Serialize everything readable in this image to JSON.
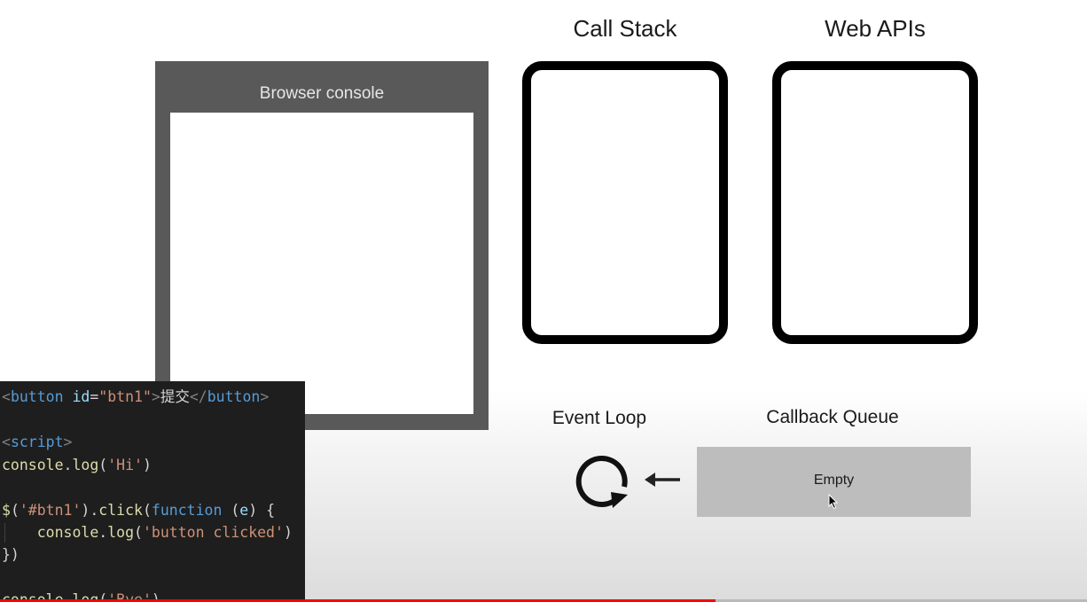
{
  "console": {
    "title": "Browser console"
  },
  "titles": {
    "call_stack": "Call Stack",
    "web_apis": "Web APIs",
    "event_loop": "Event Loop",
    "callback_queue": "Callback Queue"
  },
  "callback_queue": {
    "content": "Empty"
  },
  "icons": {
    "loop": "refresh-loop-icon",
    "arrow": "left-arrow-icon",
    "cursor": "mouse-pointer-icon"
  },
  "code": {
    "l1": {
      "t1": "<",
      "t2": "button",
      "t3": " ",
      "t4": "id",
      "t5": "=",
      "t6": "\"btn1\"",
      "t7": ">",
      "t8": "提交",
      "t9": "</",
      "t10": "button",
      "t11": ">"
    },
    "l3": {
      "t1": "<",
      "t2": "script",
      "t3": ">"
    },
    "l4": {
      "t1": "console",
      "t2": ".",
      "t3": "log",
      "t4": "(",
      "t5": "'Hi'",
      "t6": ")"
    },
    "l6": {
      "t1": "$",
      "t2": "(",
      "t3": "'#btn1'",
      "t4": ").",
      "t5": "click",
      "t6": "(",
      "t7": "function",
      "t8": " (",
      "t9": "e",
      "t10": ") {"
    },
    "l7": {
      "t1": "    ",
      "t2": "console",
      "t3": ".",
      "t4": "log",
      "t5": "(",
      "t6": "'button clicked'",
      "t7": ")"
    },
    "l8": {
      "t1": "})"
    },
    "l10": {
      "t1": "console",
      "t2": ".",
      "t3": "log",
      "t4": "(",
      "t5": "'Bye'",
      "t6": ")"
    }
  },
  "video_progress": 0.658,
  "colors": {
    "progress": "#ff0000",
    "code_bg": "#1e1e1e",
    "console_frame": "#595959",
    "queue_bg": "#bdbdbd"
  }
}
